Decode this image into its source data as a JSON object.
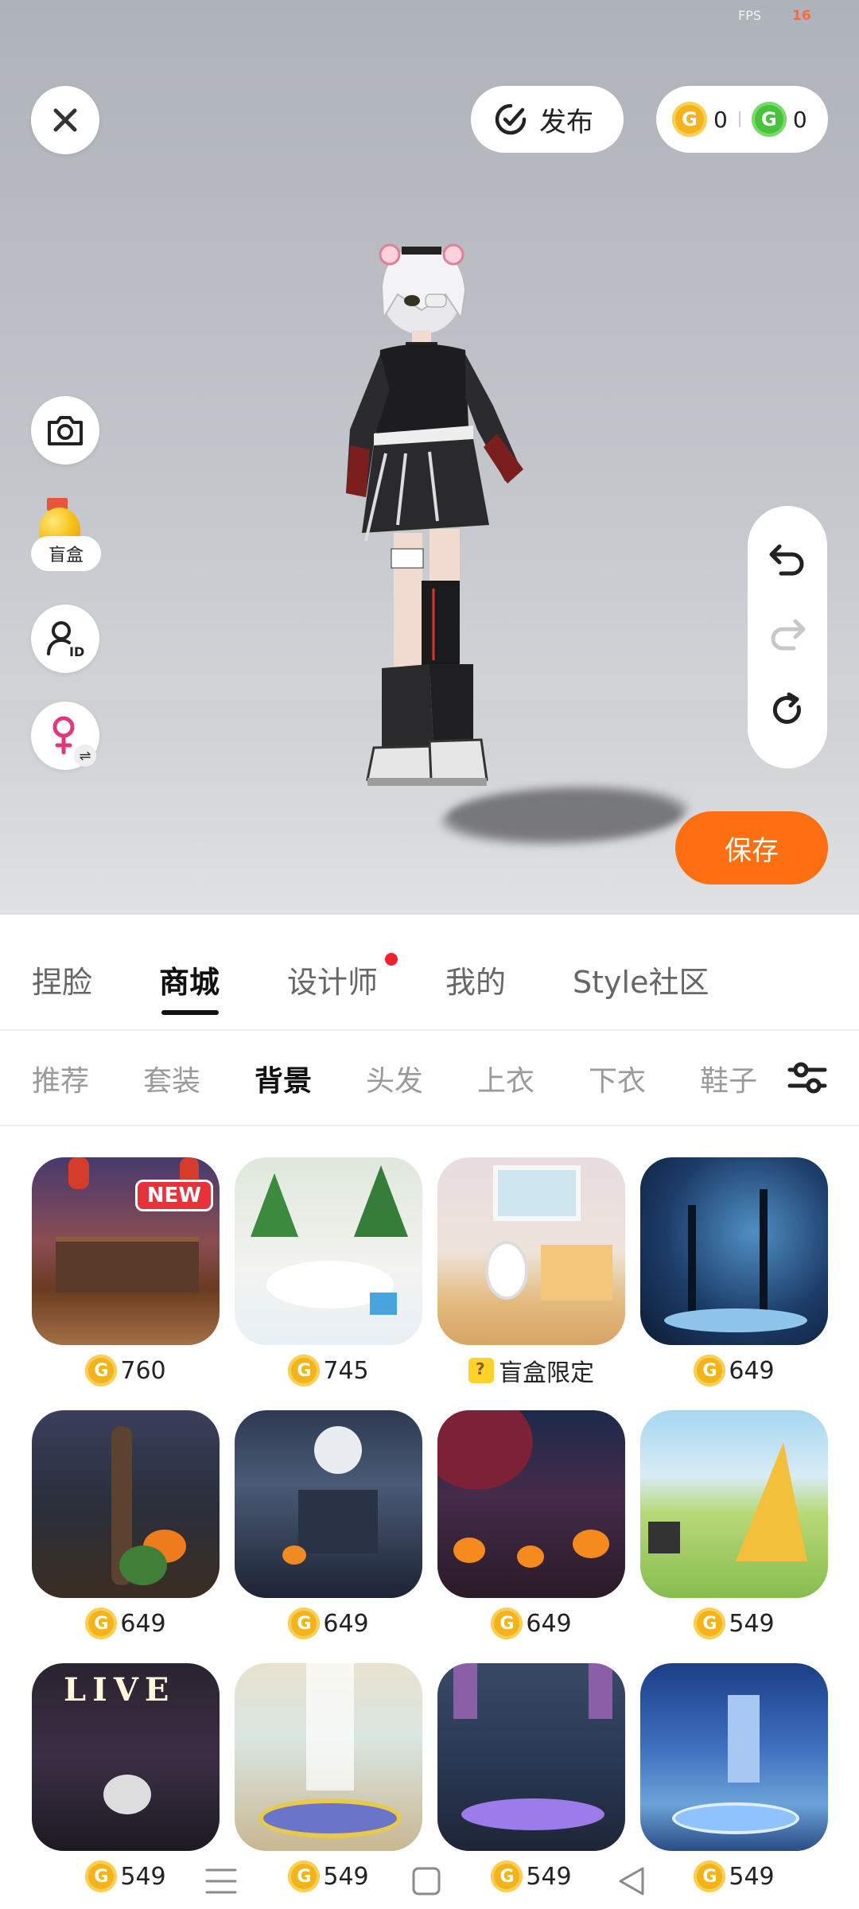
{
  "debug": {
    "fps_label": "FPS",
    "fps_value": "16"
  },
  "header": {
    "publish_label": "发布",
    "gold_coin_count": "0",
    "green_coin_count": "0"
  },
  "left_tools": {
    "blind_box_label": "盲盒"
  },
  "save_label": "保存",
  "main_tabs": [
    {
      "label": "捏脸"
    },
    {
      "label": "商城"
    },
    {
      "label": "设计师"
    },
    {
      "label": "我的"
    },
    {
      "label": "Style社区"
    }
  ],
  "active_main_tab": "商城",
  "sub_tabs": [
    {
      "label": "推荐"
    },
    {
      "label": "套装"
    },
    {
      "label": "背景"
    },
    {
      "label": "头发"
    },
    {
      "label": "上衣"
    },
    {
      "label": "下衣"
    },
    {
      "label": "鞋子"
    }
  ],
  "active_sub_tab": "背景",
  "items": [
    {
      "price": "760",
      "tag": "NEW",
      "theme": "chinese-courtyard"
    },
    {
      "price": "745",
      "theme": "christmas-snow"
    },
    {
      "price": "盲盒限定",
      "blind_box": true,
      "theme": "cozy-room"
    },
    {
      "price": "649",
      "theme": "night-forest"
    },
    {
      "price": "649",
      "theme": "halloween-tree"
    },
    {
      "price": "649",
      "theme": "haunted-house"
    },
    {
      "price": "649",
      "theme": "pumpkin-night"
    },
    {
      "price": "549",
      "theme": "camping-tent"
    },
    {
      "price": "549",
      "theme": "live-stage"
    },
    {
      "price": "549",
      "theme": "glass-hall"
    },
    {
      "price": "549",
      "theme": "crystal-palace"
    },
    {
      "price": "549",
      "theme": "ice-castle"
    }
  ],
  "colors": {
    "accent": "#fd6f11",
    "gold_coin": "#f4b21b",
    "green_coin": "#48c33b",
    "notification_dot": "#f0222c"
  },
  "icons": {
    "close": "close-icon",
    "publish": "publish-icon",
    "camera": "camera-icon",
    "id": "user-id-icon",
    "gender": "female-icon",
    "undo": "undo-icon",
    "redo": "redo-icon",
    "reset": "reset-icon",
    "filter": "filter-sliders-icon"
  }
}
